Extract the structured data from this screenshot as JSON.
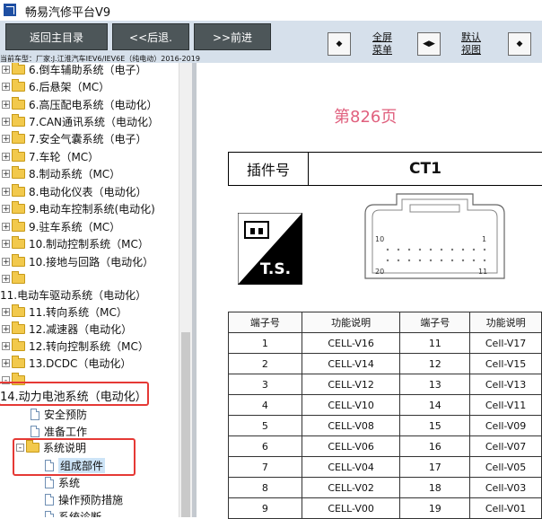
{
  "window": {
    "title": "畅易汽修平台V9"
  },
  "toolbar": {
    "home_label": "返回主目录",
    "back_label": "<<后退.",
    "forward_label": ">>前进",
    "fullscreen_label": "全屏\n菜单",
    "default_view_label": "默认\n视图"
  },
  "car_info": "当前车型：厂家:J.江淮汽车IEV6/IEV6E（纯电动）2016-2019",
  "tree": {
    "items": [
      {
        "label": "6.倒车辅助系统（电子）"
      },
      {
        "label": "6.后悬架（MC）"
      },
      {
        "label": "6.高压配电系统（电动化）"
      },
      {
        "label": "7.CAN通讯系统（电动化）"
      },
      {
        "label": "7.安全气囊系统（电子）"
      },
      {
        "label": "7.车轮（MC）"
      },
      {
        "label": "8.制动系统（MC）"
      },
      {
        "label": "8.电动化仪表（电动化）"
      },
      {
        "label": "9.电动车控制系统(电动化)"
      },
      {
        "label": "9.驻车系统（MC）"
      },
      {
        "label": "10.制动控制系统（MC）"
      },
      {
        "label": "10.接地与回路（电动化）"
      },
      {
        "label": ""
      },
      {
        "label": "11.电动车驱动系统（电动化）"
      },
      {
        "label": "11.转向系统（MC）"
      },
      {
        "label": "12.减速器（电动化）"
      },
      {
        "label": "12.转向控制系统（MC）"
      },
      {
        "label": "13.DCDC（电动化）"
      },
      {
        "label": ""
      },
      {
        "label": "14.动力电池系统（电动化）"
      },
      {
        "label": "安全预防"
      },
      {
        "label": "准备工作"
      },
      {
        "label": "系统说明"
      },
      {
        "label": "组成部件"
      },
      {
        "label": "系统"
      },
      {
        "label": "操作预防措施"
      },
      {
        "label": "系统诊断"
      }
    ]
  },
  "document": {
    "page_label": "第826页",
    "connector_header": "插件号",
    "connector_id": "CT1",
    "ts_logo_text": "T.S.",
    "pin_labels": {
      "p10": "10",
      "p1": "1",
      "p20": "20",
      "p11": "11"
    },
    "table": {
      "headers": [
        "端子号",
        "功能说明",
        "端子号",
        "功能说明"
      ],
      "rows": [
        [
          "1",
          "CELL-V16",
          "11",
          "Cell-V17"
        ],
        [
          "2",
          "CELL-V14",
          "12",
          "Cell-V15"
        ],
        [
          "3",
          "CELL-V12",
          "13",
          "Cell-V13"
        ],
        [
          "4",
          "CELL-V10",
          "14",
          "Cell-V11"
        ],
        [
          "5",
          "CELL-V08",
          "15",
          "Cell-V09"
        ],
        [
          "6",
          "CELL-V06",
          "16",
          "Cell-V07"
        ],
        [
          "7",
          "CELL-V04",
          "17",
          "Cell-V05"
        ],
        [
          "8",
          "CELL-V02",
          "18",
          "Cell-V03"
        ],
        [
          "9",
          "CELL-V00",
          "19",
          "Cell-V01"
        ]
      ]
    }
  },
  "colors": {
    "toolbar_bg": "#d6e0eb",
    "nav_button_bg": "#4d5659",
    "highlight_red": "#e53935",
    "page_label": "#e0607e",
    "selected_bg": "#cde4f7"
  }
}
